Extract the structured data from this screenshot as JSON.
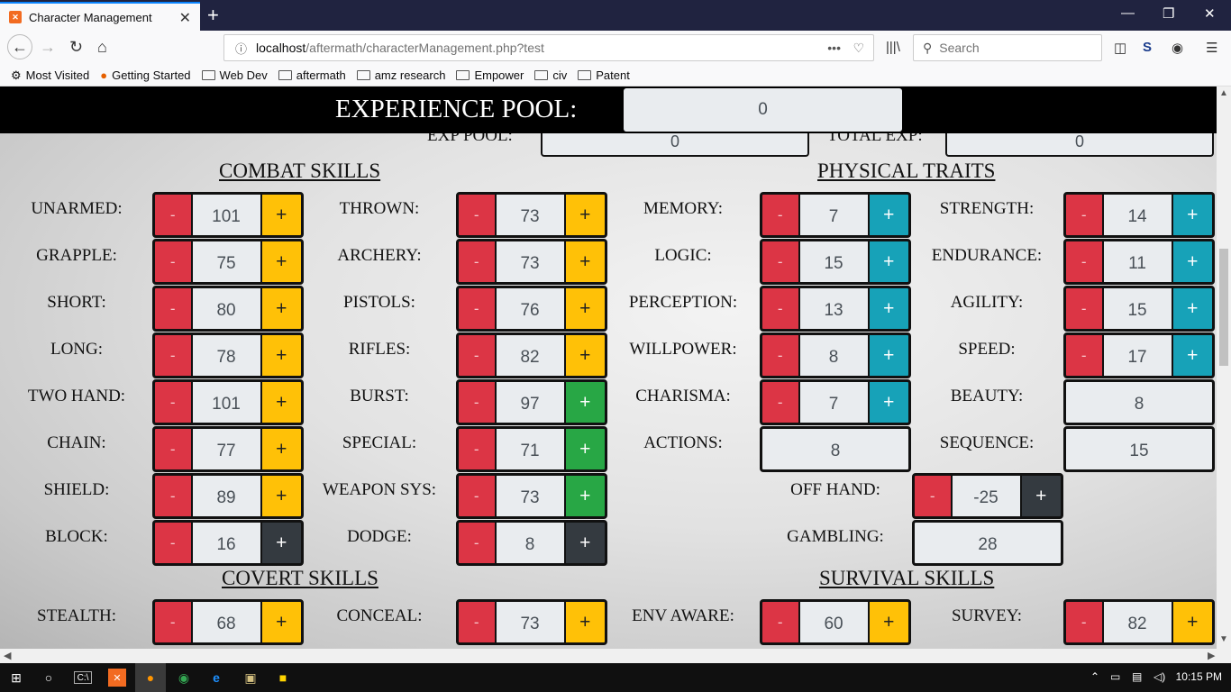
{
  "browser": {
    "tab_title": "Character Management",
    "url_host": "localhost",
    "url_path": "/aftermath/characterManagement.php?test",
    "search_placeholder": "Search",
    "bookmarks": [
      "Most Visited",
      "Getting Started",
      "Web Dev",
      "aftermath",
      "amz research",
      "Empower",
      "civ",
      "Patent"
    ]
  },
  "page": {
    "experience_pool_label": "EXPERIENCE POOL:",
    "experience_pool_value": "0",
    "hidden_row": {
      "xp_pool_label": "EXP POOL:",
      "xp_pool_value": "0",
      "total_exp_label": "TOTAL EXP:",
      "total_exp_value": "0"
    },
    "combat_title": "COMBAT SKILLS",
    "physical_title": "PHYSICAL TRAITS",
    "covert_title": "COVERT SKILLS",
    "survival_title": "SURVIVAL SKILLS",
    "minus": "-",
    "plus": "+",
    "combat_col1": [
      {
        "label": "UNARMED:",
        "value": "101",
        "plus_color": "yellow"
      },
      {
        "label": "GRAPPLE:",
        "value": "75",
        "plus_color": "yellow"
      },
      {
        "label": "SHORT:",
        "value": "80",
        "plus_color": "yellow"
      },
      {
        "label": "LONG:",
        "value": "78",
        "plus_color": "yellow"
      },
      {
        "label": "TWO HAND:",
        "value": "101",
        "plus_color": "yellow"
      },
      {
        "label": "CHAIN:",
        "value": "77",
        "plus_color": "yellow"
      },
      {
        "label": "SHIELD:",
        "value": "89",
        "plus_color": "yellow"
      },
      {
        "label": "BLOCK:",
        "value": "16",
        "plus_color": "dark"
      }
    ],
    "combat_col2": [
      {
        "label": "THROWN:",
        "value": "73",
        "plus_color": "yellow"
      },
      {
        "label": "ARCHERY:",
        "value": "73",
        "plus_color": "yellow"
      },
      {
        "label": "PISTOLS:",
        "value": "76",
        "plus_color": "yellow"
      },
      {
        "label": "RIFLES:",
        "value": "82",
        "plus_color": "yellow"
      },
      {
        "label": "BURST:",
        "value": "97",
        "plus_color": "green"
      },
      {
        "label": "SPECIAL:",
        "value": "71",
        "plus_color": "green"
      },
      {
        "label": "WEAPON SYS:",
        "value": "73",
        "plus_color": "green"
      },
      {
        "label": "DODGE:",
        "value": "8",
        "plus_color": "dark"
      }
    ],
    "physical_col1": [
      {
        "label": "MEMORY:",
        "value": "7",
        "plus_color": "teal"
      },
      {
        "label": "LOGIC:",
        "value": "15",
        "plus_color": "teal"
      },
      {
        "label": "PERCEPTION:",
        "value": "13",
        "plus_color": "teal"
      },
      {
        "label": "WILLPOWER:",
        "value": "8",
        "plus_color": "teal"
      },
      {
        "label": "CHARISMA:",
        "value": "7",
        "plus_color": "teal"
      },
      {
        "label": "ACTIONS:",
        "value": "8",
        "plus_color": "none"
      }
    ],
    "physical_col2": [
      {
        "label": "STRENGTH:",
        "value": "14",
        "plus_color": "teal"
      },
      {
        "label": "ENDURANCE:",
        "value": "11",
        "plus_color": "teal"
      },
      {
        "label": "AGILITY:",
        "value": "15",
        "plus_color": "teal"
      },
      {
        "label": "SPEED:",
        "value": "17",
        "plus_color": "teal"
      },
      {
        "label": "BEAUTY:",
        "value": "8",
        "plus_color": "none"
      },
      {
        "label": "SEQUENCE:",
        "value": "15",
        "plus_color": "none"
      }
    ],
    "off_hand": {
      "label": "OFF HAND:",
      "value": "-25",
      "plus_color": "dark"
    },
    "gambling": {
      "label": "GAMBLING:",
      "value": "28"
    },
    "covert_row": [
      {
        "label": "STEALTH:",
        "value": "68",
        "plus_color": "yellow"
      },
      {
        "label": "CONCEAL:",
        "value": "73",
        "plus_color": "yellow"
      }
    ],
    "survival_row": [
      {
        "label": "ENV AWARE:",
        "value": "60",
        "plus_color": "yellow"
      },
      {
        "label": "SURVEY:",
        "value": "82",
        "plus_color": "yellow"
      }
    ]
  },
  "taskbar": {
    "time": "10:15 PM"
  },
  "colors": {
    "minus": "#dc3545",
    "yellow": "#ffc107",
    "teal": "#17a2b8",
    "green": "#28a745",
    "dark": "#343a40"
  }
}
